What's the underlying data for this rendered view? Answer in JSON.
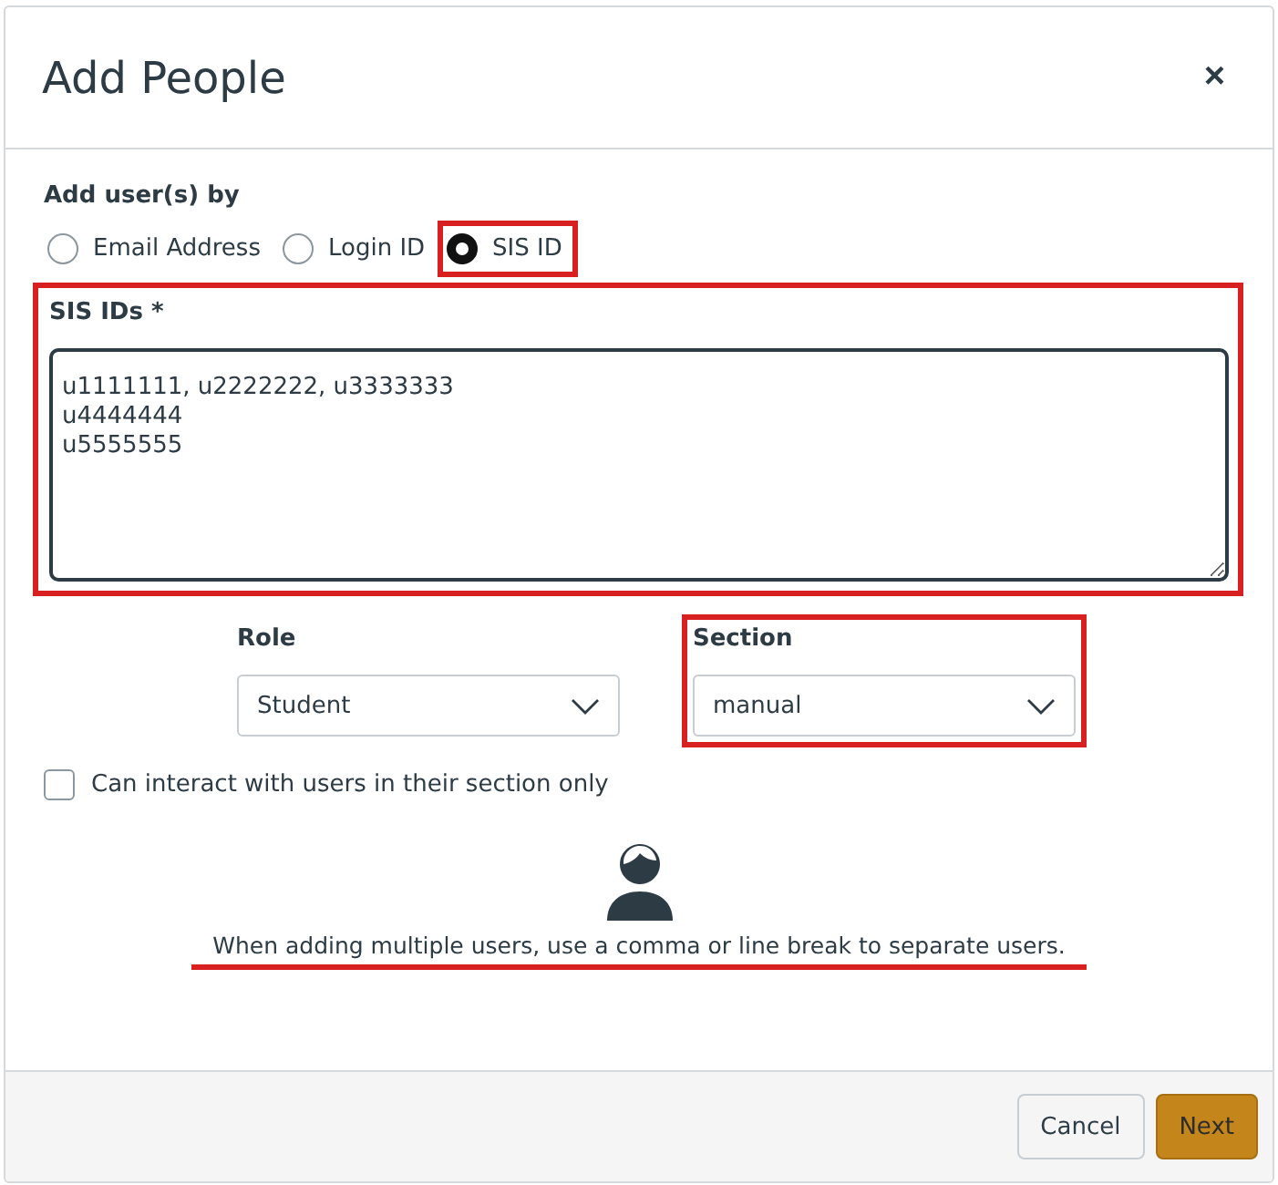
{
  "dialog": {
    "title": "Add People",
    "close": "×"
  },
  "add_by": {
    "label": "Add user(s) by",
    "options": [
      {
        "label": "Email Address",
        "selected": false,
        "highlighted": false
      },
      {
        "label": "Login ID",
        "selected": false,
        "highlighted": false
      },
      {
        "label": "SIS ID",
        "selected": true,
        "highlighted": true
      }
    ]
  },
  "ids_field": {
    "label": "SIS IDs *",
    "value": "u1111111, u2222222, u3333333\nu4444444\nu5555555",
    "highlighted": true
  },
  "selects": [
    {
      "label": "Role",
      "value": "Student",
      "highlighted": false
    },
    {
      "label": "Section",
      "value": "manual",
      "highlighted": true
    }
  ],
  "section_only": {
    "label": "Can interact with users in their section only",
    "checked": false
  },
  "hint": {
    "text": "When adding multiple users, use a comma or line break to separate users.",
    "highlighted": true
  },
  "buttons": [
    {
      "label": "Cancel",
      "kind": "secondary"
    },
    {
      "label": "Next",
      "kind": "primary"
    }
  ]
}
